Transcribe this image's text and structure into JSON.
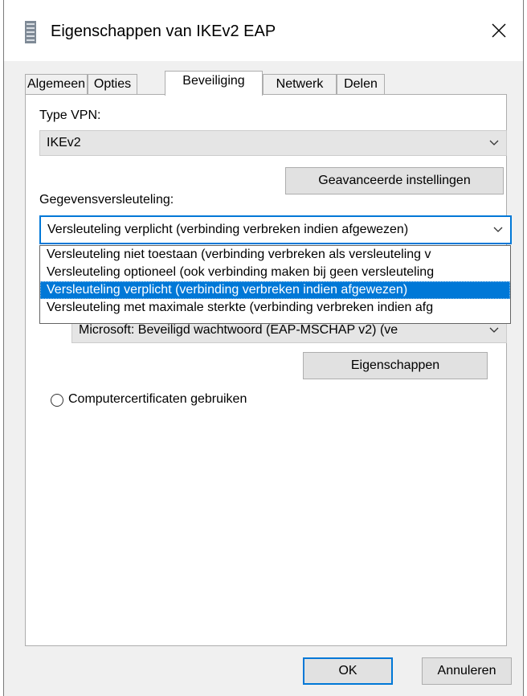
{
  "window": {
    "title": "Eigenschappen van IKEv2 EAP",
    "close_icon": "close-icon",
    "app_icon": "network-connection-icon"
  },
  "tabs": [
    {
      "label": "Algemeen"
    },
    {
      "label": "Opties"
    },
    {
      "label": "Beveiliging",
      "active": true
    },
    {
      "label": "Netwerk"
    },
    {
      "label": "Delen"
    }
  ],
  "vpn_type": {
    "label": "Type VPN:",
    "value": "IKEv2"
  },
  "advanced_button": {
    "label": "Geavanceerde instellingen"
  },
  "encryption": {
    "label": "Gegevensversleuteling:",
    "value": "Versleuteling verplicht (verbinding verbreken indien afgewezen)",
    "options": [
      "Versleuteling niet toestaan (verbinding verbreken als versleuteling v",
      "Versleuteling optioneel (ook verbinding maken bij geen versleuteling",
      "Versleuteling verplicht (verbinding verbreken indien afgewezen)",
      "Versleuteling met maximale sterkte (verbinding verbreken indien afg"
    ],
    "selected_index": 2
  },
  "eap_method": {
    "value": "Microsoft: Beveiligd wachtwoord (EAP-MSCHAP v2) (ve"
  },
  "properties_button": {
    "label": "Eigenschappen"
  },
  "computer_certs": {
    "label": "Computercertificaten gebruiken",
    "checked": false
  },
  "footer": {
    "ok_label": "OK",
    "cancel_label": "Annuleren"
  }
}
